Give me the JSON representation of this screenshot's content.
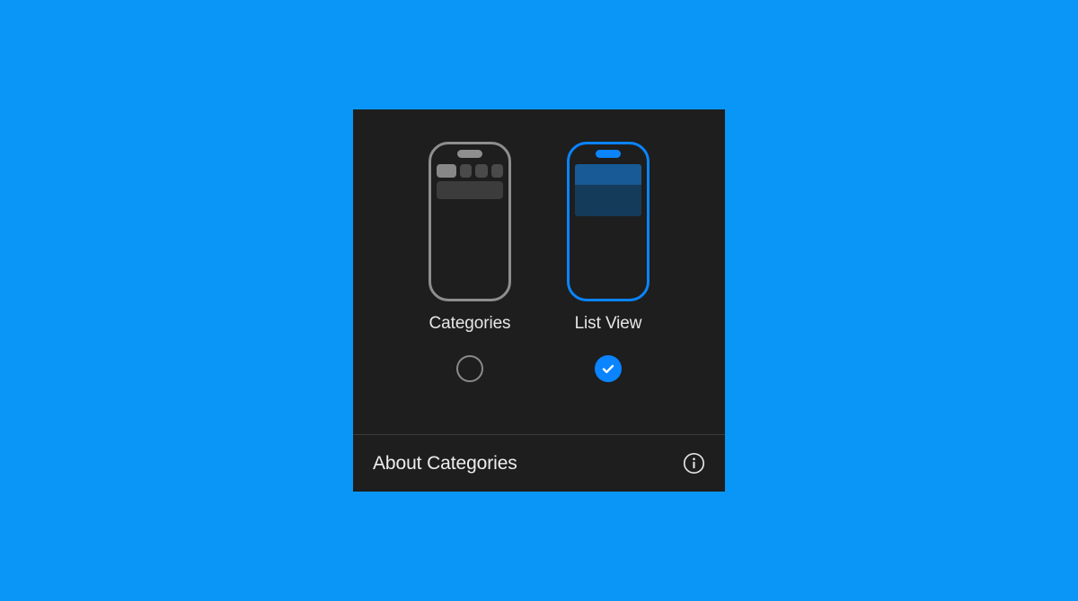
{
  "options": {
    "categories": {
      "label": "Categories",
      "selected": false
    },
    "list_view": {
      "label": "List View",
      "selected": true
    }
  },
  "footer": {
    "about_label": "About Categories"
  },
  "colors": {
    "accent": "#0a84ff",
    "panel_bg": "#1e1e1e",
    "page_bg": "#0a96f7",
    "inactive": "#8e8e8f"
  }
}
